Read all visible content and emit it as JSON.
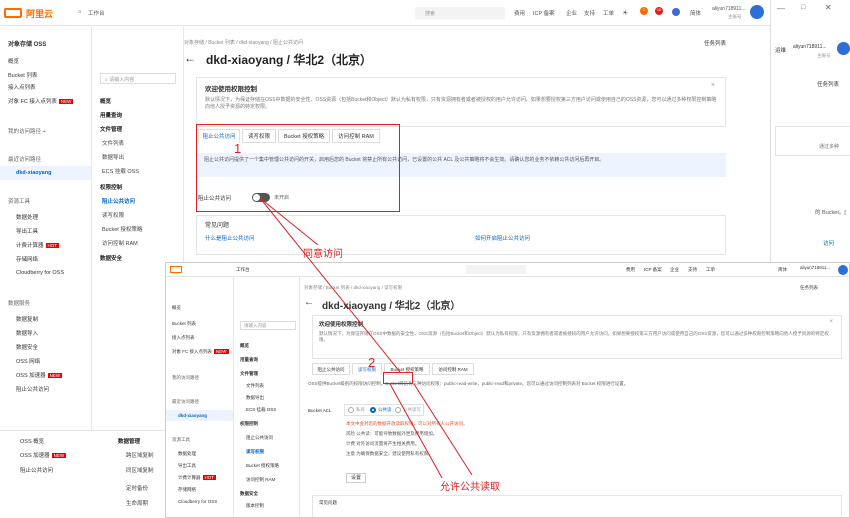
{
  "topbar": {
    "logo": "阿里云",
    "workspace": "工作台",
    "search_placeholder": "搜索",
    "nav": [
      "费用",
      "ICP 备案",
      "企业",
      "支持",
      "工单"
    ],
    "lang": "简体",
    "user": "aliyun718911...",
    "user_sub": "主账号",
    "badge1": "1",
    "badge2": "10"
  },
  "sidebar": {
    "header": "对象存储 OSS",
    "items": [
      "概览",
      "Bucket 列表",
      "接入点列表",
      "对象 FC 接入点列表"
    ],
    "new_label": "NEW",
    "sections": [
      {
        "title": "我的访问路径",
        "icon": "+"
      },
      {
        "title": "最近访问路径",
        "sub": "dkd-xiaoyang"
      },
      {
        "title": "资源工具",
        "items": [
          "数据处理",
          "导出工具",
          "计费计算器",
          "存储网络",
          "Cloudberry for OSS"
        ],
        "hot": "HOT"
      },
      {
        "title": "数据服务",
        "items": [
          "数据复制",
          "数据导入",
          "数据安全",
          "OSS 网络",
          "OSS 加速器",
          "阻止公共访问"
        ]
      }
    ]
  },
  "subnav": {
    "search_placeholder": "请输入内容",
    "items": [
      "概览",
      "用量查询",
      "文件管理",
      "文件列表",
      "数据导出",
      "ECS 挂载 OSS",
      "权限控制",
      "阻止公共访问",
      "读写权限",
      "Bucket 授权策略",
      "访问控制 RAM",
      "数据安全",
      "版本控制",
      "防盗链",
      "跨域设置",
      "保留策略",
      "服务端加密",
      "TLS版本设置",
      "数据管理",
      "跨区域复制",
      "同区域复制",
      "定时备份",
      "生命周期"
    ]
  },
  "main": {
    "breadcrumb": [
      "对象存储",
      "Bucket 列表",
      "dkd-xiaoyang",
      "阻止公共访问"
    ],
    "title": "dkd-xiaoyang / 华北2（北京）",
    "task_link": "任务列表",
    "welcome_title": "欢迎使用权限控制",
    "welcome_text": "默认情况下，为保证存储在OSS中数据的安全性，OSS资源（包括Bucket和Object）默认为私有权限，只有资源拥有者或者被授权的用户允许访问。如果想要授权第三方用户访问或使用自己的OSS资源，您可以通过多种权限控制策略向他人授予资源的特定权限。",
    "tabs": [
      "阻止公共访问",
      "读写权限",
      "Bucket 授权策略",
      "访问控制 RAM"
    ],
    "info_text": "阻止公共访问提供了一个集中管理公共访问的开关，启用后您的 Bucket 将禁止所有公共访问，已设置的公共 ACL 及公共策略将不会生效。请确认您的业务不依赖公共访问后再开启。",
    "toggle_label": "阻止公共访问",
    "toggle_state": "未开启",
    "faq_title": "常见问题",
    "faq_links": [
      "什么是阻止公共访问",
      "如何开启阻止公共访问"
    ]
  },
  "annotations": {
    "label1": "1",
    "text1": "同意访问",
    "label2": "2",
    "text2": "允许公共读取"
  },
  "rightwin": {
    "item1": "运维",
    "user": "aliyun718911...",
    "user_sub": "主账号",
    "task": "任务列表",
    "text1": "通过多种",
    "text2": "的 Bucket。[",
    "text3": "访问"
  },
  "shot2": {
    "workspace": "工作台",
    "breadcrumb": [
      "对象存储",
      "Bucket 列表",
      "dkd-xiaoyang",
      "读写权限"
    ],
    "title": "dkd-xiaoyang / 华北2（北京）",
    "task_link": "任务列表",
    "welcome_title": "欢迎使用权限控制",
    "welcome_text": "默认情况下，为保证存储在OSS中数据的安全性，OSS资源（包括Bucket和Object）默认为私有权限，只有资源拥有者或者被授权的用户允许访问。如果想要授权第三方用户访问或使用自己的OSS资源，您可以通过多种权限控制策略向他人授予资源的特定权限。",
    "tabs": [
      "阻止公共访问",
      "读写权限",
      "Bucket 授权策略",
      "访问控制 RAM"
    ],
    "acl_desc": "OSS提供Bucket级别的权限访问控制。Bucket目前有三种访问权限：public-read-write，public-read和private。您可以通过访问控制列表对 Bucket 权限进行设置。",
    "acl_label": "Bucket ACL",
    "acl_options": [
      "私有",
      "公共读",
      "公共读写"
    ],
    "acl_note": "本文中会对您的数据开放读取权限，可以对所有人公开访问。",
    "acl_lines": [
      "风险 公共读：可能导致数据外泄及费用增加。",
      "计费 对外访问流量将产生相关费用。",
      "注意 为确保数据安全，建议使用私有权限。"
    ],
    "set_button": "设置",
    "faq_title": "常见问题",
    "sidebar_items": [
      "概览",
      "Bucket 列表",
      "接入点列表",
      "对象 FC 接入点列表"
    ],
    "sidebar_bottom": [
      "OSS 概览",
      "OSS 加速器",
      "阻止公共访问"
    ],
    "subnav_items": [
      "概览",
      "用量查询",
      "文件管理",
      "文件列表",
      "数据导出",
      "ECS 挂载 OSS",
      "权限控制",
      "阻止公共访问",
      "读写权限",
      "Bucket 授权策略",
      "访问控制 RAM",
      "数据安全",
      "版本控制",
      "防盗链"
    ],
    "subnav_bottom": [
      "数据管理",
      "跨区域复制",
      "同区域复制",
      "定时备份",
      "生命周期"
    ]
  }
}
